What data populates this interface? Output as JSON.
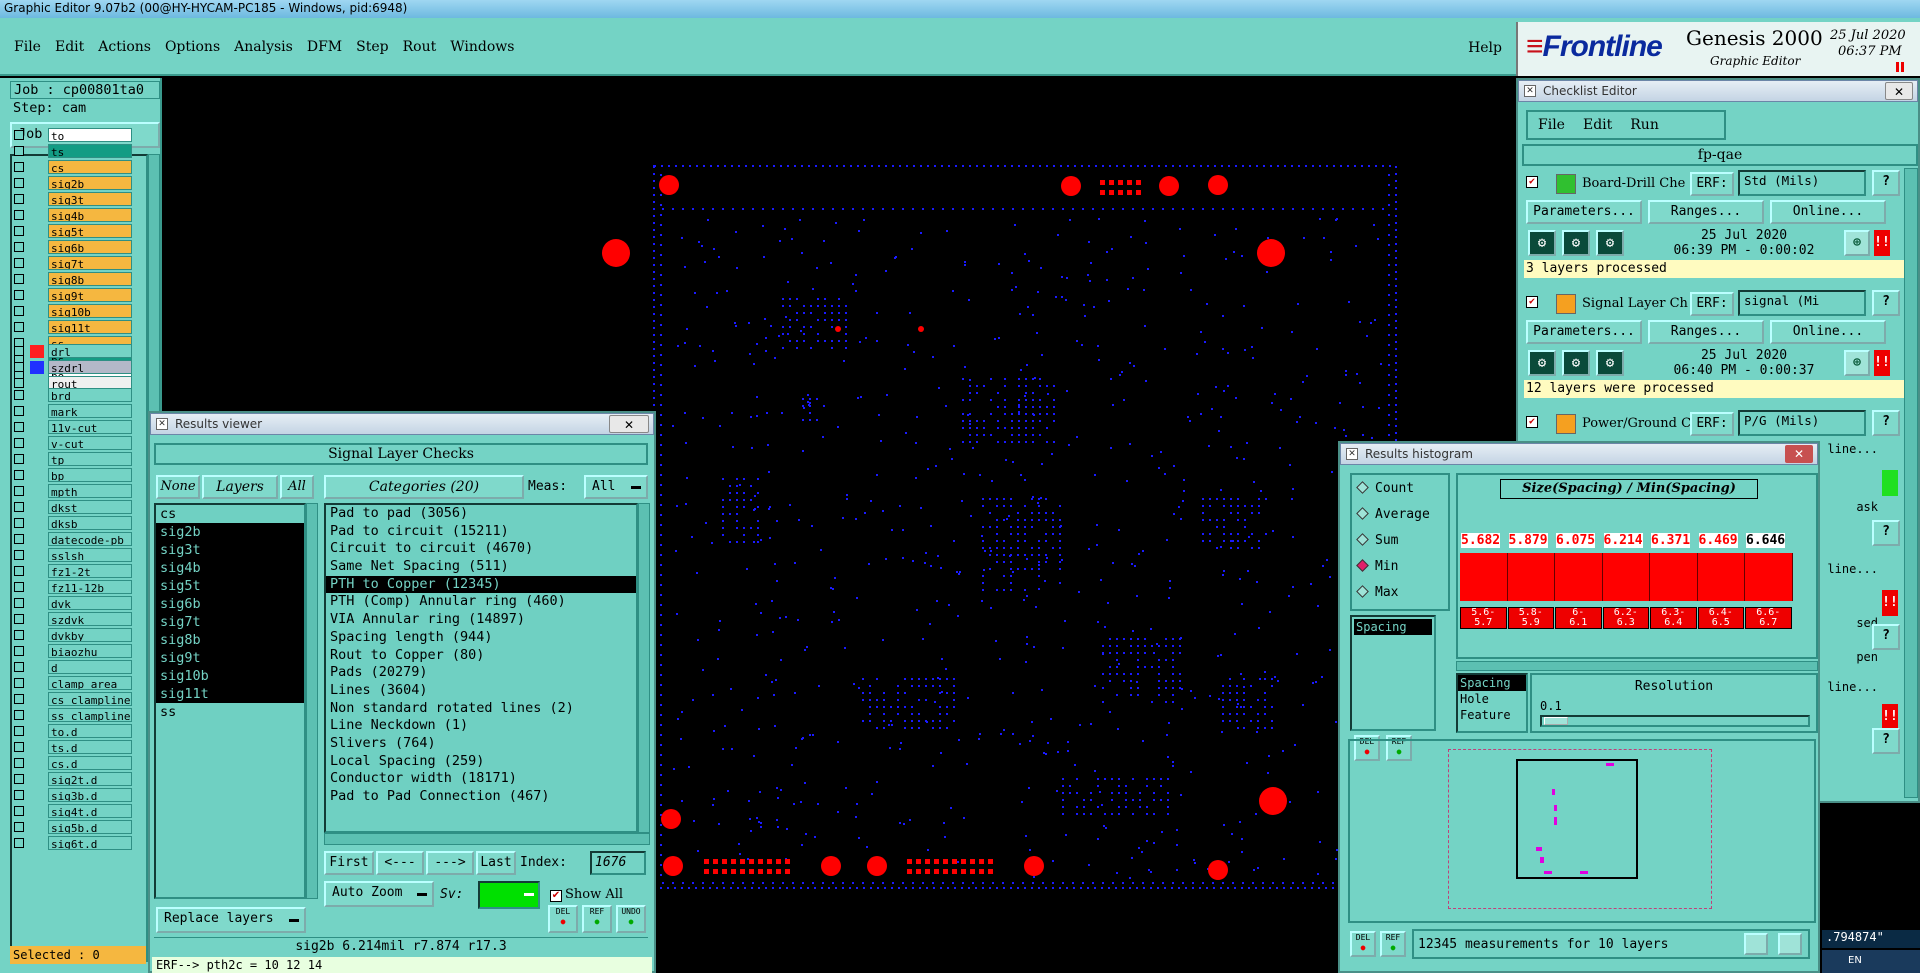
{
  "window_title": "Graphic Editor 9.07b2 (00@HY-HYCAM-PC185 - Windows, pid:6948)",
  "menu": {
    "items": [
      "File",
      "Edit",
      "Actions",
      "Options",
      "Analysis",
      "DFM",
      "Step",
      "Rout",
      "Windows"
    ],
    "help": "Help"
  },
  "brand": {
    "logo": "Frontline",
    "product": "Genesis 2000",
    "sub": "Graphic Editor",
    "date": "25 Jul 2020",
    "time": "06:37 PM"
  },
  "job": {
    "job_label": "Job : cp00801ta0",
    "step_label": "Step: cam",
    "matrix_button": "Job Matrix ..."
  },
  "layers_top": [
    {
      "name": "to",
      "color": "#ffffff"
    },
    {
      "name": "ts",
      "color": "#139c84"
    },
    {
      "name": "cs",
      "color": "#f5b740"
    },
    {
      "name": "sig2b",
      "color": "#f5b740"
    },
    {
      "name": "sig3t",
      "color": "#f5b740"
    },
    {
      "name": "sig4b",
      "color": "#f5b740"
    },
    {
      "name": "sig5t",
      "color": "#f5b740"
    },
    {
      "name": "sig6b",
      "color": "#f5b740"
    },
    {
      "name": "sig7t",
      "color": "#f5b740"
    },
    {
      "name": "sig8b",
      "color": "#f5b740"
    },
    {
      "name": "sig9t",
      "color": "#f5b740"
    },
    {
      "name": "sig10b",
      "color": "#f5b740"
    },
    {
      "name": "sig11t",
      "color": "#f5b740"
    },
    {
      "name": "ss",
      "color": "#f5b740"
    },
    {
      "name": "bs",
      "color": "#139c84"
    },
    {
      "name": "bo",
      "color": "#ffffff"
    }
  ],
  "layers_drill": [
    {
      "name": "drl",
      "color": "#74d3c5"
    },
    {
      "name": "szdrl",
      "color": "#b4b8c8"
    },
    {
      "name": "rout",
      "color": "#f0f0f0"
    }
  ],
  "layers_misc": [
    "brd",
    "mark",
    "11v-cut",
    "v-cut",
    "tp",
    "bp",
    "mpth",
    "dkst",
    "dksb",
    "datecode-pb",
    "sslsh",
    "fz1-2t",
    "fz11-12b",
    "dvk",
    "szdvk",
    "dvkby",
    "biaozhu",
    "d",
    "clamp_area",
    "cs_clampline",
    "ss_clampline",
    "to.d",
    "ts.d",
    "cs.d",
    "sig2t.d",
    "sig3b.d",
    "sig4t.d",
    "sig5b.d",
    "sig6t.d"
  ],
  "selected_label": "Selected : 0",
  "results_viewer": {
    "title": "Results viewer",
    "header": "Signal Layer Checks",
    "none_btn": "None",
    "layers_btn": "Layers",
    "all_btn": "All",
    "categories_btn": "Categories (20)",
    "meas_label": "Meas:",
    "meas_value": "All",
    "layers": [
      {
        "name": "cs",
        "sel": false
      },
      {
        "name": "sig2b",
        "sel": true
      },
      {
        "name": "sig3t",
        "sel": true
      },
      {
        "name": "sig4b",
        "sel": true
      },
      {
        "name": "sig5t",
        "sel": true
      },
      {
        "name": "sig6b",
        "sel": true
      },
      {
        "name": "sig7t",
        "sel": true
      },
      {
        "name": "sig8b",
        "sel": true
      },
      {
        "name": "sig9t",
        "sel": true
      },
      {
        "name": "sig10b",
        "sel": true
      },
      {
        "name": "sig11t",
        "sel": true
      },
      {
        "name": "ss",
        "sel": false
      }
    ],
    "categories": [
      {
        "name": "Pad to pad (3056)",
        "sel": false
      },
      {
        "name": "Pad to circuit (15211)",
        "sel": false
      },
      {
        "name": "Circuit to circuit (4670)",
        "sel": false
      },
      {
        "name": "Same Net Spacing (511)",
        "sel": false
      },
      {
        "name": "PTH to Copper (12345)",
        "sel": true
      },
      {
        "name": "PTH (Comp) Annular ring (460)",
        "sel": false
      },
      {
        "name": "VIA Annular ring (14897)",
        "sel": false
      },
      {
        "name": "Spacing length (944)",
        "sel": false
      },
      {
        "name": "Rout to Copper (80)",
        "sel": false
      },
      {
        "name": "Pads (20279)",
        "sel": false
      },
      {
        "name": "Lines (3604)",
        "sel": false
      },
      {
        "name": "Non standard rotated lines (2)",
        "sel": false
      },
      {
        "name": "Line Neckdown (1)",
        "sel": false
      },
      {
        "name": "Slivers (764)",
        "sel": false
      },
      {
        "name": "Local Spacing (259)",
        "sel": false
      },
      {
        "name": "Conductor width (18171)",
        "sel": false
      },
      {
        "name": "Pad to Pad Connection (467)",
        "sel": false
      }
    ],
    "first_btn": "First",
    "prev_btn": "<---",
    "next_btn": "--->",
    "last_btn": "Last",
    "index_label": "Index:",
    "index_value": "1676",
    "autozoom_btn": "Auto Zoom",
    "sv_label": "Sv:",
    "show_all": "Show All",
    "replace_btn": "Replace layers",
    "del": "DEL",
    "ref": "REF",
    "undo": "UNDO",
    "status": "sig2b 6.214mil   r7.874  r17.3"
  },
  "erf_line": "ERF--> pth2c = 10 12 14",
  "checklist": {
    "title": "Checklist Editor",
    "menu": [
      "File",
      "Edit",
      "Run"
    ],
    "name": "fp-qae",
    "erf_label": "ERF:",
    "params_btn": "Parameters...",
    "ranges_btn": "Ranges...",
    "online_btn": "Online...",
    "items": [
      {
        "name": "Board-Drill Che",
        "erf": "Std (Mils)",
        "date": "25 Jul 2020",
        "time": "06:39 PM - 0:00:02",
        "status": "3 layers processed"
      },
      {
        "name": "Signal Layer Ch",
        "erf": "signal (Mi",
        "date": "25 Jul 2020",
        "time": "06:40 PM - 0:00:37",
        "status": "12 layers were processed"
      },
      {
        "name": "Power/Ground C",
        "erf": "P/G (Mils)"
      }
    ],
    "partial": [
      "line...",
      "ask",
      "line...",
      "sed",
      "pen",
      "line..."
    ]
  },
  "histogram": {
    "title": "Results histogram",
    "modes": [
      {
        "name": "Count",
        "on": false
      },
      {
        "name": "Average",
        "on": false
      },
      {
        "name": "Sum",
        "on": false
      },
      {
        "name": "Min",
        "on": true
      },
      {
        "name": "Max",
        "on": false
      }
    ],
    "measure": "Spacing",
    "chart_title": "Size(Spacing) / Min(Spacing)",
    "bars": [
      {
        "value": "5.682",
        "range": [
          "5.6-",
          "5.7"
        ]
      },
      {
        "value": "5.879",
        "range": [
          "5.8-",
          "5.9"
        ]
      },
      {
        "value": "6.075",
        "range": [
          "6-",
          "6.1"
        ]
      },
      {
        "value": "6.214",
        "range": [
          "6.2-",
          "6.3"
        ]
      },
      {
        "value": "6.371",
        "range": [
          "6.3-",
          "6.4"
        ]
      },
      {
        "value": "6.469",
        "range": [
          "6.4-",
          "6.5"
        ]
      },
      {
        "value": "6.646",
        "range": [
          "6.6-",
          "6.7"
        ]
      }
    ],
    "field_list": [
      "Spacing",
      "Hole",
      "Feature"
    ],
    "resolution_label": "Resolution",
    "resolution_value": "0.1",
    "status": "12345 measurements for 10 layers",
    "del": "DEL",
    "ref": "REF"
  },
  "coord_readout": ".794874\"",
  "tray": "EN",
  "colors": {
    "panel": "#74d3c5",
    "accent": "#ff0000",
    "canvas": "#000000",
    "copper": "#1a1aff"
  }
}
